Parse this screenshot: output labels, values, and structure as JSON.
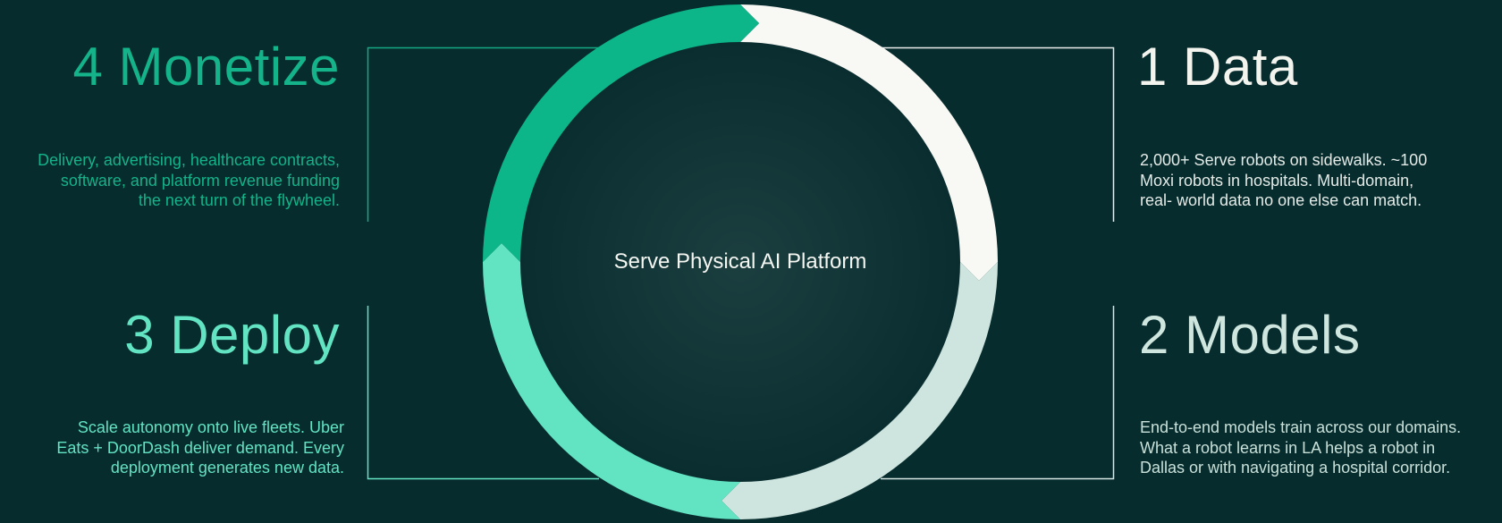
{
  "center": {
    "label": "Serve Physical AI Platform"
  },
  "stages": {
    "data": {
      "title": "1 Data",
      "description": "2,000+ Serve robots on sidewalks. ~100\nMoxi robots in hospitals. Multi-domain,\nreal- world data no one else can match."
    },
    "models": {
      "title": "2 Models",
      "description": "End-to-end models train across our domains.\nWhat a robot learns in LA helps a robot in\nDallas or with navigating a hospital corridor."
    },
    "deploy": {
      "title": "3 Deploy",
      "description": "Scale autonomy onto live fleets. Uber\nEats + DoorDash deliver demand. Every\ndeployment generates new data."
    },
    "monetize": {
      "title": "4 Monetize",
      "description": "Delivery, advertising, healthcare contracts,\nsoftware, and platform revenue funding\nthe next turn of the flywheel."
    }
  },
  "colors": {
    "background": "#072c2e",
    "monetize": "#0cb689",
    "data": "#f8f8f4",
    "models": "#cde5de",
    "deploy": "#62e3c2",
    "bracket_monetize": "#14a883",
    "bracket_data": "#e9ece9",
    "bracket_models": "#d6e6e1",
    "bracket_deploy": "#62e3c2"
  }
}
